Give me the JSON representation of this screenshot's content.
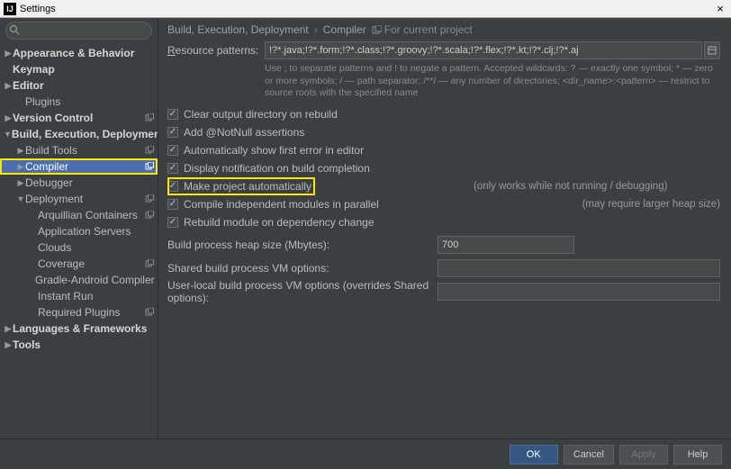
{
  "window": {
    "title": "Settings"
  },
  "sidebar": {
    "search_placeholder": "",
    "items": [
      {
        "label": "Appearance & Behavior",
        "level": 0,
        "arrow": "right",
        "top": true
      },
      {
        "label": "Keymap",
        "level": 0,
        "arrow": "none",
        "top": true
      },
      {
        "label": "Editor",
        "level": 0,
        "arrow": "right",
        "top": true
      },
      {
        "label": "Plugins",
        "level": 1,
        "arrow": "none",
        "top": false
      },
      {
        "label": "Version Control",
        "level": 0,
        "arrow": "right",
        "top": true,
        "proj": true
      },
      {
        "label": "Build, Execution, Deployment",
        "level": 0,
        "arrow": "down",
        "top": true
      },
      {
        "label": "Build Tools",
        "level": 1,
        "arrow": "right",
        "top": false,
        "proj": true
      },
      {
        "label": "Compiler",
        "level": 1,
        "arrow": "right",
        "top": false,
        "selected": true,
        "proj": true,
        "highlight": true
      },
      {
        "label": "Debugger",
        "level": 1,
        "arrow": "right",
        "top": false
      },
      {
        "label": "Deployment",
        "level": 1,
        "arrow": "down",
        "top": false,
        "proj": true
      },
      {
        "label": "Arquillian Containers",
        "level": 2,
        "arrow": "none",
        "top": false,
        "proj": true
      },
      {
        "label": "Application Servers",
        "level": 2,
        "arrow": "none",
        "top": false
      },
      {
        "label": "Clouds",
        "level": 2,
        "arrow": "none",
        "top": false
      },
      {
        "label": "Coverage",
        "level": 2,
        "arrow": "none",
        "top": false,
        "proj": true
      },
      {
        "label": "Gradle-Android Compiler",
        "level": 2,
        "arrow": "none",
        "top": false,
        "proj": true
      },
      {
        "label": "Instant Run",
        "level": 2,
        "arrow": "none",
        "top": false
      },
      {
        "label": "Required Plugins",
        "level": 2,
        "arrow": "none",
        "top": false,
        "proj": true
      },
      {
        "label": "Languages & Frameworks",
        "level": 0,
        "arrow": "right",
        "top": true
      },
      {
        "label": "Tools",
        "level": 0,
        "arrow": "right",
        "top": true
      }
    ]
  },
  "breadcrumb": {
    "a": "Build, Execution, Deployment",
    "b": "Compiler",
    "for_project": "For current project"
  },
  "fields": {
    "resource_label": "Resource patterns:",
    "resource_value": "!?*.java;!?*.form;!?*.class;!?*.groovy;!?*.scala;!?*.flex;!?*.kt;!?*.clj;!?*.aj",
    "hint1": "Use ; to separate patterns and ! to negate a pattern. Accepted wildcards: ? — exactly one symbol; * — zero or more symbols; / — path separator; /**/ — any number of directories; <dir_name>:<pattern> — restrict to source roots with the specified name"
  },
  "checks": {
    "clear_output": "Clear output directory on rebuild",
    "add_notnull": "Add @NotNull assertions",
    "auto_error": "Automatically show first error in editor",
    "display_notif": "Display notification on build completion",
    "make_auto": "Make project automatically",
    "make_auto_note": "(only works while not running / debugging)",
    "compile_par": "Compile independent modules in parallel",
    "compile_par_note": "(may require larger heap size)",
    "rebuild_dep": "Rebuild module on dependency change"
  },
  "numfields": {
    "heap_label": "Build process heap size (Mbytes):",
    "heap_value": "700",
    "shared_label": "Shared build process VM options:",
    "shared_value": "",
    "user_label": "User-local build process VM options (overrides Shared options):",
    "user_value": ""
  },
  "buttons": {
    "ok": "OK",
    "cancel": "Cancel",
    "apply": "Apply",
    "help": "Help"
  }
}
